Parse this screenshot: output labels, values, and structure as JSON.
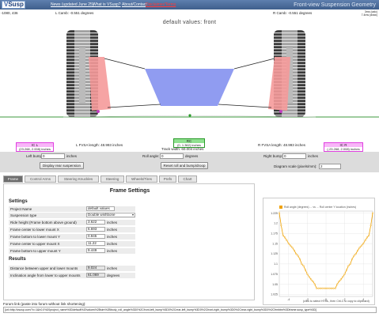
{
  "header": {
    "logo_a": "V",
    "logo_b": "Susp",
    "nav": [
      "News (updated June 25)",
      "What is VSusp?",
      "About/Contact"
    ],
    "nav_disclaimer": "Disclaimer/Terms",
    "title": "Front-view Suspension Geometry"
  },
  "canvas": {
    "coords": "-1080, 436",
    "left_camber": "L Camb: -0.551",
    "right_camber": "R Camb: -0.551",
    "camber_unit": "degrees",
    "timing_1": "3ms (calc)",
    "timing_2": "7.4ms (draw)",
    "title": "default values: front"
  },
  "ic_left": {
    "title": "IC L",
    "value": "(23.268, 2.008)",
    "unit": "inches"
  },
  "ic_right": {
    "title": "IC R",
    "value": "(-23.268, 2.008)",
    "unit": "inches"
  },
  "rc": {
    "title": "RC",
    "value": "(0, 1.362)",
    "unit": "inches"
  },
  "labels": {
    "l_fvsa": "L FVSA length: 48.993",
    "r_fvsa": "R FVSA length: 48.993",
    "track_width": "Track width: 60.004",
    "unit": "inches"
  },
  "controls": {
    "left_bump_label": "Left bump:",
    "left_bump_value": "0",
    "roll_angle_label": "Roll angle:",
    "roll_angle_value": "0",
    "right_bump_label": "Right bump:",
    "right_bump_value": "0",
    "inches": "inches",
    "degrees": "degrees",
    "display_rear": "Display rear suspension",
    "reset": "Reset roll and bump/droop",
    "diagram_scale_label": "Diagram scale (pixels/mm):",
    "diagram_scale_value": "2"
  },
  "tabs": [
    "Frame",
    "Control Arms",
    "Steering Knuckles",
    "Steering",
    "Wheels/Tires",
    "Prefs",
    "Chart"
  ],
  "frame": {
    "title": "Frame Settings",
    "settings_heading": "Settings",
    "rows": [
      {
        "label": "Project Name",
        "value": "default values",
        "unit": ""
      },
      {
        "label": "Suspension type",
        "value": "Double wishbone",
        "unit": ""
      },
      {
        "label": "Ride height (Frame bottom above ground)",
        "value": "3.622",
        "unit": "inches"
      },
      {
        "label": "Frame center to lower mount X",
        "value": "6.693",
        "unit": "inches"
      },
      {
        "label": "Frame bottom to lower mount Y",
        "value": "0.945",
        "unit": "inches"
      },
      {
        "label": "Frame center to upper mount X",
        "value": "11.22",
        "unit": "inches"
      },
      {
        "label": "Frame bottom to upper mount Y",
        "value": "9.449",
        "unit": "inches"
      }
    ],
    "results_heading": "Results",
    "results": [
      {
        "label": "Distance between upper and lower mounts",
        "value": "9.024",
        "unit": "inches"
      },
      {
        "label": "Inclination angle from lower to upper mounts",
        "value": "61.069",
        "unit": "degrees"
      }
    ]
  },
  "chart_data": {
    "type": "line",
    "legend": "Roll angle (degrees) ... vs ... Roll center Y location (inches)",
    "note": "(click to select HTML, then Ctrl-C to copy to clipboard)",
    "x_ticks": [
      "-4",
      "-2",
      "0",
      "2",
      "4"
    ],
    "y_ticks": [
      "1.225",
      "1.2",
      "1.175",
      "1.15",
      "1.125",
      "1.1",
      "1.075",
      "1.05",
      "1.025"
    ],
    "xlim": [
      -5,
      5
    ],
    "ylim": [
      1.02,
      1.23
    ],
    "x": [
      -5,
      -4.8,
      -4.6,
      -4.4,
      -4.2,
      -4.0,
      -3.8,
      -3.6,
      -3.4,
      -3.2,
      -3.0,
      -2.8,
      -2.6,
      -2.4,
      -2.2,
      -2.0,
      -1.8,
      -1.6,
      -1.4,
      -1.2,
      -1.0,
      -0.8,
      -0.6,
      -0.4,
      -0.2,
      0,
      0.2,
      0.4,
      0.6,
      0.8,
      1.0,
      1.2,
      1.4,
      1.6,
      1.8,
      2.0,
      2.2,
      2.4,
      2.6,
      2.8,
      3.0,
      3.2,
      3.4,
      3.6,
      3.8,
      4.0,
      4.2,
      4.4,
      4.6,
      4.8,
      5
    ],
    "y": [
      1.225,
      1.195,
      1.17,
      1.165,
      1.158,
      1.15,
      1.145,
      1.14,
      1.133,
      1.125,
      1.12,
      1.112,
      1.1,
      1.095,
      1.085,
      1.075,
      1.068,
      1.062,
      1.057,
      1.05,
      1.04,
      1.04,
      1.04,
      1.04,
      1.04,
      1.04,
      1.04,
      1.04,
      1.04,
      1.04,
      1.04,
      1.05,
      1.057,
      1.062,
      1.068,
      1.075,
      1.085,
      1.095,
      1.1,
      1.112,
      1.12,
      1.125,
      1.133,
      1.14,
      1.145,
      1.15,
      1.158,
      1.165,
      1.17,
      1.195,
      1.225
    ]
  },
  "footer": {
    "label": "Forum link (paste into forum without link shortening):",
    "url": "[url=http://vsusp.com/?v=1&h0.0%20project_name%3Ddefault%20values%2Bsim%2Bbody_roll_angle%3D0%2Cfront-left_bump%3D0%2Crear-left_bump%3D0%2Cfront-right_bump%3D0%2Crear-right_bump%3D0%2Cfrmbtm%3Dframe.susp_type%3D]"
  },
  "colors": {
    "header": "#4a6c9c",
    "arm": "#f08080",
    "frame": "#6e7ef0",
    "ic": "#e040e0",
    "rc": "#2a9a2a",
    "line": "#f0a200"
  }
}
